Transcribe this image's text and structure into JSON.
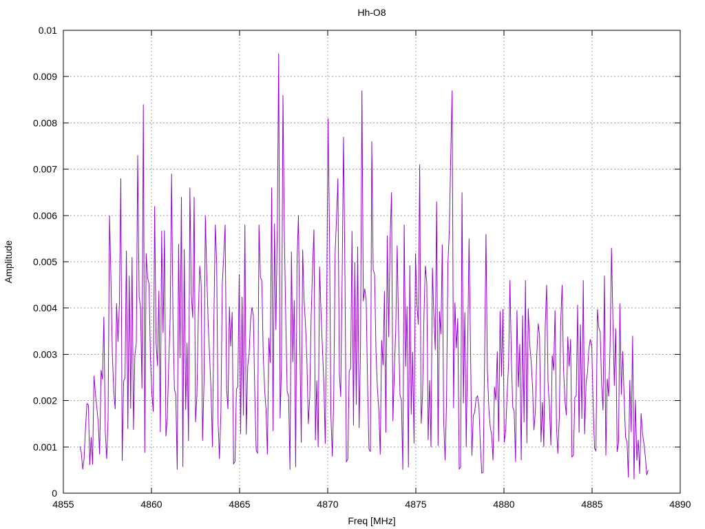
{
  "page": {
    "background": "#ffffff"
  },
  "chart_data": {
    "type": "line",
    "title": "Hh-O8",
    "xlabel": "Freq [MHz]",
    "ylabel": "Amplitude",
    "xlim": [
      4855,
      4890
    ],
    "ylim": [
      0,
      0.01
    ],
    "x_ticks": [
      4855,
      4860,
      4865,
      4870,
      4875,
      4880,
      4885,
      4890
    ],
    "x_tick_labels": [
      "4855",
      "4860",
      "4865",
      "4870",
      "4875",
      "4880",
      "4885",
      "4890"
    ],
    "y_ticks": [
      0,
      0.001,
      0.002,
      0.003,
      0.004,
      0.005,
      0.006,
      0.007,
      0.008,
      0.009,
      0.01
    ],
    "y_tick_labels": [
      "0",
      "0.001",
      "0.002",
      "0.003",
      "0.004",
      "0.005",
      "0.006",
      "0.007",
      "0.008",
      "0.009",
      "0.01"
    ],
    "grid": "dotted",
    "legend": "none",
    "line_color": "#9400d3",
    "grid_color": "#9c9c9c",
    "axis_color": "#000000",
    "series": [
      {
        "name": "Hh-O8 spectrum",
        "style": "noisy line spectrum",
        "x_start": 4855.94,
        "dx": 0.08,
        "n_points": 404,
        "amp_floor": 8e-05,
        "noise_step": 53,
        "envelope_keyframes": [
          [
            4855.9,
            0.0008,
            0.0007
          ],
          [
            4856.5,
            0.0014,
            0.0011
          ],
          [
            4857.2,
            0.0022,
            0.0017
          ],
          [
            4858.0,
            0.0028,
            0.0024
          ],
          [
            4859.0,
            0.0031,
            0.0027
          ],
          [
            4860.0,
            0.003,
            0.0026
          ],
          [
            4861.0,
            0.0032,
            0.0028
          ],
          [
            4862.0,
            0.0032,
            0.0028
          ],
          [
            4863.0,
            0.003,
            0.0026
          ],
          [
            4864.0,
            0.0028,
            0.0024
          ],
          [
            4865.0,
            0.0027,
            0.0023
          ],
          [
            4866.0,
            0.003,
            0.0026
          ],
          [
            4867.0,
            0.0032,
            0.0028
          ],
          [
            4868.0,
            0.0031,
            0.0027
          ],
          [
            4869.0,
            0.003,
            0.0026
          ],
          [
            4870.0,
            0.0032,
            0.0028
          ],
          [
            4871.0,
            0.0032,
            0.0028
          ],
          [
            4872.0,
            0.0032,
            0.0028
          ],
          [
            4873.0,
            0.0031,
            0.0027
          ],
          [
            4874.0,
            0.003,
            0.0026
          ],
          [
            4875.0,
            0.003,
            0.0026
          ],
          [
            4876.0,
            0.0031,
            0.0027
          ],
          [
            4877.0,
            0.003,
            0.0027
          ],
          [
            4878.0,
            0.002,
            0.0017
          ],
          [
            4878.6,
            0.0014,
            0.0013
          ],
          [
            4879.5,
            0.0022,
            0.0017
          ],
          [
            4880.5,
            0.0025,
            0.0019
          ],
          [
            4882.0,
            0.0024,
            0.0018
          ],
          [
            4883.5,
            0.0024,
            0.0018
          ],
          [
            4885.0,
            0.0025,
            0.0019
          ],
          [
            4886.0,
            0.0023,
            0.0018
          ],
          [
            4887.0,
            0.0016,
            0.0013
          ],
          [
            4888.2,
            0.0007,
            0.0006
          ]
        ],
        "noise_table": [
          0.62,
          0.13,
          0.87,
          0.45,
          0.31,
          0.95,
          0.22,
          0.56,
          0.74,
          0.08,
          0.49,
          0.91,
          0.35,
          0.67,
          0.18,
          0.82,
          0.41,
          0.05,
          0.77,
          0.58,
          0.29,
          0.93,
          0.12,
          0.64,
          0.38,
          0.85,
          0.21,
          0.71,
          0.51,
          0.03,
          0.89,
          0.33,
          0.6,
          0.15,
          0.97,
          0.44,
          0.26,
          0.79,
          0.09,
          0.68,
          0.53,
          0.88,
          0.19,
          0.4,
          0.75,
          0.3,
          0.99,
          0.07,
          0.57,
          0.36,
          0.83,
          0.14,
          0.65,
          0.47,
          0.92,
          0.25,
          0.7,
          0.02,
          0.61,
          0.43,
          0.96,
          0.17,
          0.54,
          0.34,
          0.81,
          0.1,
          0.72,
          0.48,
          0.27,
          0.94,
          0.06,
          0.59,
          0.39,
          0.86,
          0.23,
          0.66,
          0.5,
          0.11,
          0.78,
          0.32
        ],
        "peaks": [
          [
            4857.6,
            0.006
          ],
          [
            4858.25,
            0.0068
          ],
          [
            4859.2,
            0.0073
          ],
          [
            4859.55,
            0.0084
          ],
          [
            4860.2,
            0.0062
          ],
          [
            4861.1,
            0.0069
          ],
          [
            4861.7,
            0.0064
          ],
          [
            4862.15,
            0.0066
          ],
          [
            4862.4,
            0.0064
          ],
          [
            4863.05,
            0.006
          ],
          [
            4863.6,
            0.0058
          ],
          [
            4864.2,
            0.0058
          ],
          [
            4865.3,
            0.0058
          ],
          [
            4866.1,
            0.0058
          ],
          [
            4866.8,
            0.0066
          ],
          [
            4867.25,
            0.0095
          ],
          [
            4867.45,
            0.0086
          ],
          [
            4868.3,
            0.006
          ],
          [
            4869.2,
            0.0057
          ],
          [
            4870.0,
            0.0081
          ],
          [
            4870.55,
            0.0068
          ],
          [
            4870.9,
            0.0077
          ],
          [
            4871.9,
            0.0087
          ],
          [
            4872.5,
            0.0076
          ],
          [
            4873.6,
            0.0065
          ],
          [
            4874.3,
            0.0058
          ],
          [
            4875.25,
            0.0071
          ],
          [
            4876.2,
            0.0063
          ],
          [
            4876.95,
            0.0073
          ],
          [
            4877.05,
            0.0087
          ],
          [
            4877.6,
            0.0065
          ],
          [
            4878.05,
            0.0055
          ],
          [
            4879.0,
            0.0056
          ],
          [
            4880.3,
            0.0046
          ],
          [
            4881.2,
            0.0046
          ],
          [
            4882.4,
            0.0045
          ],
          [
            4883.3,
            0.0045
          ],
          [
            4884.5,
            0.0046
          ],
          [
            4885.7,
            0.0047
          ],
          [
            4886.1,
            0.0053
          ],
          [
            4886.6,
            0.0041
          ],
          [
            4887.3,
            0.0034
          ]
        ]
      }
    ]
  }
}
